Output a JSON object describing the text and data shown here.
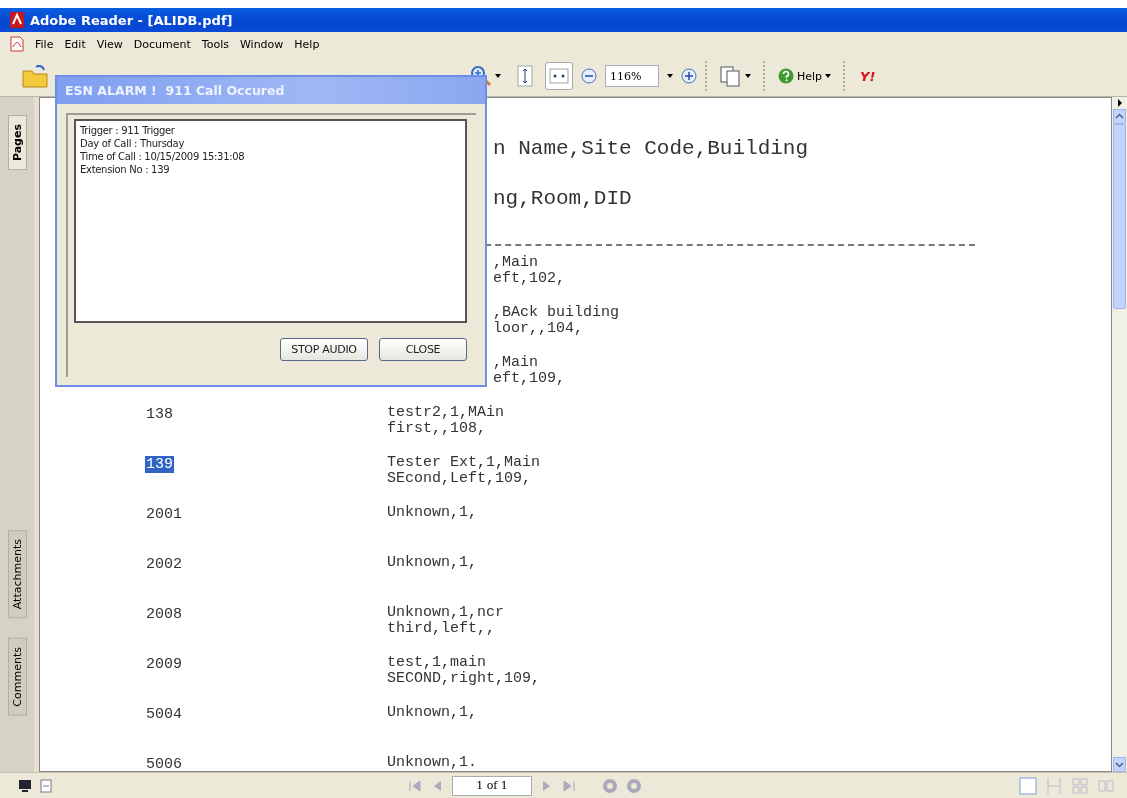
{
  "window": {
    "title": "Adobe Reader - [ALIDB.pdf]"
  },
  "menu": [
    {
      "label": "File"
    },
    {
      "label": "Edit"
    },
    {
      "label": "View"
    },
    {
      "label": "Document"
    },
    {
      "label": "Tools"
    },
    {
      "label": "Window"
    },
    {
      "label": "Help"
    }
  ],
  "toolbar": {
    "zoom": "116%",
    "help": "Help",
    "logo": "Y!"
  },
  "sidebar": {
    "tabs": [
      {
        "label": "Pages",
        "selected": true
      },
      {
        "label": "Attachments",
        "selected": false
      },
      {
        "label": "Comments",
        "selected": false
      }
    ]
  },
  "document": {
    "rows": [
      {
        "kind": "header",
        "lines": [
          "n Name,Site Code,Building"
        ]
      },
      {
        "kind": "header",
        "lines": [
          "ng,Room,DID"
        ]
      },
      {
        "kind": "rule"
      },
      {
        "kind": "partial",
        "lines": [
          ",Main",
          "eft,102,"
        ]
      },
      {
        "kind": "partial",
        "lines": [
          ",BAck building",
          "loor,,104,"
        ]
      },
      {
        "kind": "partial",
        "lines": [
          ",Main",
          "eft,109,"
        ]
      },
      {
        "kind": "entry",
        "ext": "138",
        "selected": false,
        "lines": [
          "testr2,1,MAin",
          "first,,108,"
        ]
      },
      {
        "kind": "entry",
        "ext": "139",
        "selected": true,
        "lines": [
          "Tester Ext,1,Main",
          "SEcond,Left,109,"
        ]
      },
      {
        "kind": "entry",
        "ext": "2001",
        "selected": false,
        "lines": [
          "Unknown,1,"
        ]
      },
      {
        "kind": "entry",
        "ext": "2002",
        "selected": false,
        "lines": [
          "Unknown,1,"
        ]
      },
      {
        "kind": "entry",
        "ext": "2008",
        "selected": false,
        "lines": [
          "Unknown,1,ncr",
          "third,left,,"
        ]
      },
      {
        "kind": "entry",
        "ext": "2009",
        "selected": false,
        "lines": [
          "test,1,main",
          "SECOND,right,109,"
        ]
      },
      {
        "kind": "entry",
        "ext": "5004",
        "selected": false,
        "lines": [
          "Unknown,1,"
        ]
      },
      {
        "kind": "entry",
        "ext": "5006",
        "selected": false,
        "lines": [
          "Unknown,1."
        ]
      }
    ]
  },
  "dialog": {
    "title": "ESN ALARM !  911 Call Occured",
    "lines": [
      "Trigger : 911 Trigger",
      "Day of Call : Thursday",
      "Time of Call : 10/15/2009 15:31:08",
      "Extension No : 139"
    ],
    "buttons": [
      "STOP AUDIO",
      "CLOSE"
    ]
  },
  "status_bar": {
    "page": "1 of 1"
  }
}
